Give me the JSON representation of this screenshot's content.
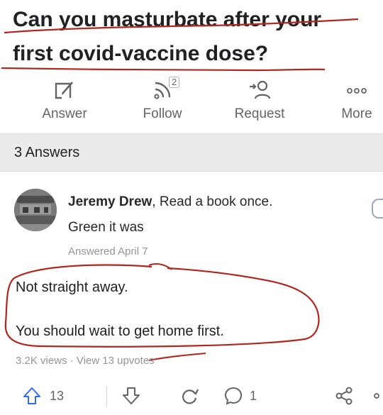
{
  "question": {
    "title_line1": "Can you masturbate after your",
    "title_line2": "first covid-vaccine dose?"
  },
  "actions": {
    "answer_label": "Answer",
    "follow_label": "Follow",
    "follow_count": "2",
    "request_label": "Request",
    "more_label": "More",
    "icons": [
      "edit-icon",
      "follow-rss-icon",
      "request-user-icon",
      "more-dots-icon"
    ]
  },
  "answers_header": "3 Answers",
  "answer": {
    "author_name": "Jeremy Drew",
    "author_credential": ", Read a book once.",
    "author_line2": "Green it was",
    "answered_date": "Answered April 7",
    "body_line1": "Not straight away.",
    "body_line2": "You should wait to get home first.",
    "stats": "3.2K views · View 13 upvotes",
    "upvote_count": "13",
    "comment_count": "1"
  },
  "colors": {
    "text": "#202124",
    "secondary": "#636466",
    "muted": "#939598",
    "annotation_red": "#b3261e",
    "bar_bg": "#ebebeb"
  }
}
